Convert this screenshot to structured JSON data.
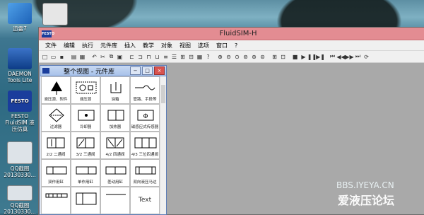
{
  "window": {
    "title": "FluidSIM-H",
    "logo_text": "FESTO"
  },
  "menu": [
    "文件",
    "编辑",
    "执行",
    "元件库",
    "插入",
    "教学",
    "对象",
    "视图",
    "选项",
    "窗口",
    "?"
  ],
  "desktop_icons": [
    {
      "label": "迅雷7"
    },
    {
      "label": "DAEMON Tools Lite"
    },
    {
      "label": "FESTO FluidSIM 液压仿真"
    },
    {
      "label": "QQ截图 20130330..."
    },
    {
      "label": "QQ截图 20130330..."
    }
  ],
  "library": {
    "title": "整个视图 - 元件库",
    "cells": [
      {
        "caption": "液压源、附件"
      },
      {
        "caption": "液压源"
      },
      {
        "caption": "油箱"
      },
      {
        "caption": "管路、手段等"
      },
      {
        "caption": "过滤器"
      },
      {
        "caption": "冷却器"
      },
      {
        "caption": "加热器"
      },
      {
        "caption": "磁感应式传感器"
      },
      {
        "caption": "2/2 二通阀"
      },
      {
        "caption": "3/2 三通阀"
      },
      {
        "caption": "4/2 四通阀"
      },
      {
        "caption": "4/3 三位四通阀"
      },
      {
        "caption": "双作用缸"
      },
      {
        "caption": "单作用缸"
      },
      {
        "caption": "差动用缸"
      },
      {
        "caption": "双向液压马达"
      },
      {
        "caption": ""
      },
      {
        "caption": ""
      },
      {
        "caption": ""
      },
      {
        "caption": "",
        "big": "Text"
      }
    ]
  },
  "watermark": {
    "line1": "BBS.IYEYA.CN",
    "line2": "爱液压论坛"
  },
  "icons": {
    "toolbar": [
      "new-icon",
      "open-icon",
      "save-icon",
      "print-icon",
      "preview-icon",
      "cut-icon",
      "copy-icon",
      "paste-icon",
      "undo-icon",
      "redo-icon",
      "align-icon",
      "align-icon",
      "align-icon",
      "align-icon",
      "align-icon",
      "align-icon",
      "zoom-in-icon",
      "zoom-out-icon",
      "grid-icon",
      "play-icon",
      "stop-icon",
      "pause-icon"
    ]
  },
  "colors": {
    "titlebar": "#e38c92",
    "libtitle": "#a8c2ea",
    "desktop": "#2f5f73"
  }
}
